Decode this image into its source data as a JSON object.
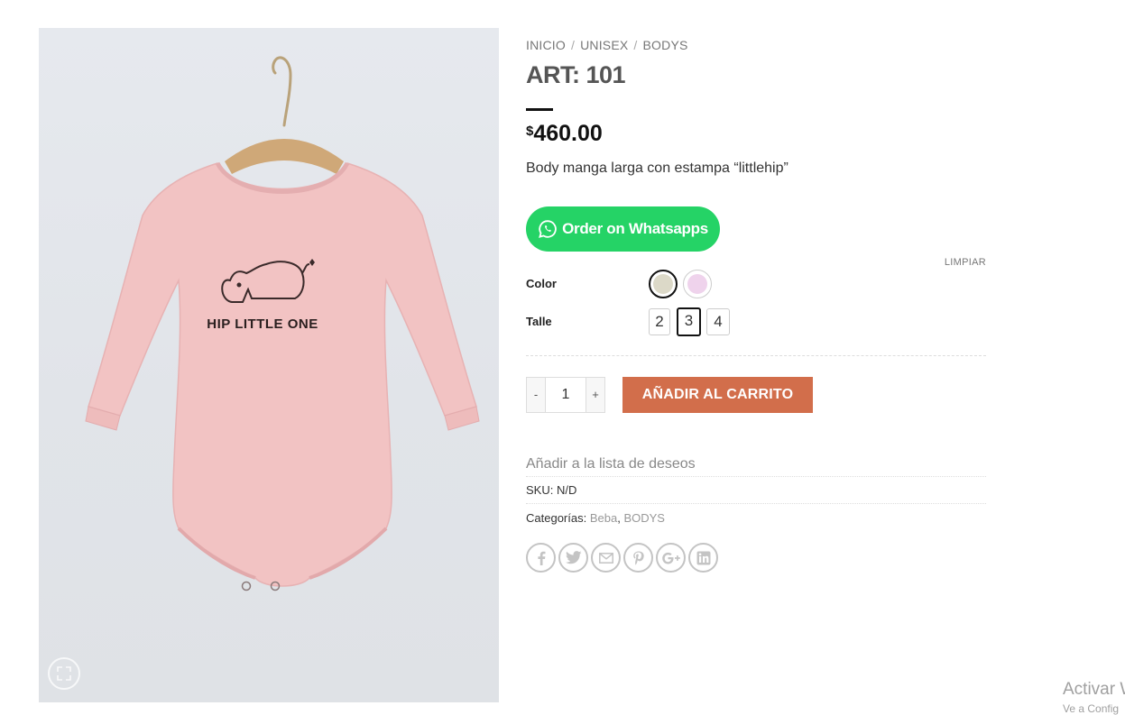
{
  "product_image": {
    "alt": "Body rosa HIP LITTLE ONE",
    "print_text": "HIP LITTLE ONE"
  },
  "breadcrumb": [
    {
      "label": "INICIO"
    },
    {
      "label": "UNISEX"
    },
    {
      "label": "BODYS"
    }
  ],
  "breadcrumb_separator": "/",
  "product": {
    "title": "ART: 101",
    "currency_symbol": "$",
    "price": "460.00",
    "description": "Body manga larga con estampa “littlehip”"
  },
  "whatsapp_button": {
    "label": "Order on Whatsapps",
    "color": "#25d366"
  },
  "variations": {
    "clear_label": "LIMPIAR",
    "color_label": "Color",
    "colors": [
      {
        "value": "#dcd9c8",
        "selected": true
      },
      {
        "value": "#efd3ec",
        "selected": false
      }
    ],
    "size_label": "Talle",
    "sizes": [
      {
        "label": "2",
        "selected": false
      },
      {
        "label": "3",
        "selected": true
      },
      {
        "label": "4",
        "selected": false
      }
    ]
  },
  "cart": {
    "minus": "-",
    "plus": "+",
    "quantity": "1",
    "add_label": "AÑADIR AL CARRITO",
    "accent": "#d26e4b"
  },
  "wishlist_label": "Añadir a la lista de deseos",
  "meta": {
    "sku_label": "SKU:",
    "sku_value": "N/D",
    "categories_label": "Categorías:",
    "categories": [
      "Beba",
      "BODYS"
    ],
    "categories_sep": ","
  },
  "share_icons": [
    "facebook-icon",
    "twitter-icon",
    "email-icon",
    "pinterest-icon",
    "google-plus-icon",
    "linkedin-icon"
  ],
  "os_watermark": {
    "line1": "Activar W",
    "line2": "Ve a Config"
  }
}
